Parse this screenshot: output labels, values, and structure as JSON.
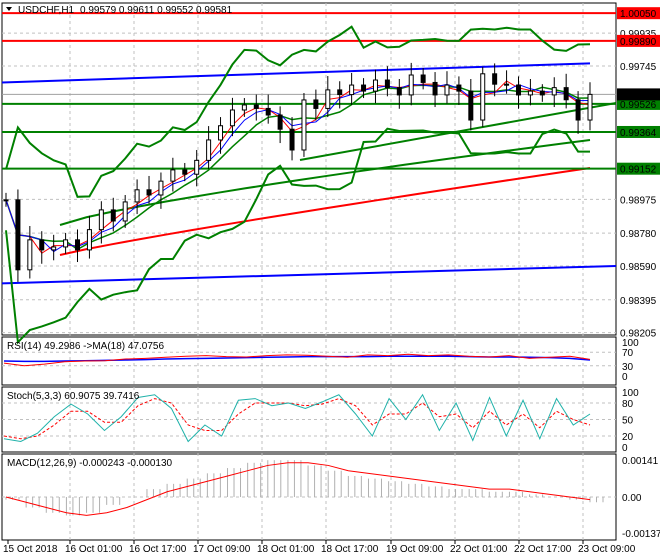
{
  "header": {
    "symbol": "USDCHF,H1",
    "ohlc": "0.99579 0.99611 0.99552 0.99581"
  },
  "chart_data": {
    "type": "line",
    "title": "USDCHF,H1",
    "price_ticks": [
      0.99935,
      0.99745,
      0.98975,
      0.9878,
      0.9859,
      0.98395,
      0.98205
    ],
    "price_range": [
      0.9816,
      1.0013
    ],
    "closes": [
      0.98972,
      0.98568,
      0.98741,
      0.98683,
      0.987,
      0.98741,
      0.98683,
      0.988,
      0.98914,
      0.9885,
      0.9896,
      0.9903,
      0.99,
      0.9908,
      0.99145,
      0.9912,
      0.992,
      0.99318,
      0.994,
      0.99491,
      0.9952,
      0.995,
      0.99462,
      0.9938,
      0.9926,
      0.99549,
      0.995,
      0.99607,
      0.9958,
      0.99635,
      0.996,
      0.99664,
      0.9962,
      0.99578,
      0.99693,
      0.9965,
      0.99578,
      0.99635,
      0.996,
      0.99433,
      0.997,
      0.9964,
      0.99635,
      0.99578,
      0.996,
      0.99578,
      0.9962,
      0.9955,
      0.99433,
      0.99581
    ],
    "levels": [
      {
        "value": 1.0005,
        "label": "1.00050",
        "color": "#ff0000"
      },
      {
        "value": 0.9989,
        "label": "0.99890",
        "color": "#ff0000"
      },
      {
        "value": 0.99526,
        "label": "0.99526",
        "color": "#008000"
      },
      {
        "value": 0.99364,
        "label": "0.99364",
        "color": "#008000"
      },
      {
        "value": 0.99152,
        "label": "0.99152",
        "color": "#008000"
      }
    ],
    "current": {
      "value": 0.99581,
      "label": "0.99581"
    },
    "trendlines": [
      {
        "from": 0.9965,
        "to": 0.9976,
        "color": "#0000ff"
      },
      {
        "from": 0.9849,
        "to": 0.9859,
        "color": "#0000ff"
      }
    ],
    "x_labels": [
      "15 Oct 2018",
      "16 Oct 01:00",
      "16 Oct 17:00",
      "17 Oct 09:00",
      "18 Oct 01:00",
      "18 Oct 17:00",
      "19 Oct 09:00",
      "22 Oct 01:00",
      "22 Oct 17:00",
      "23 Oct 09:00"
    ],
    "rsi": {
      "label": "RSI(14) 49.2986  ->MA(18) 47.0756",
      "ticks": [
        "100",
        "70",
        "30",
        "0"
      ],
      "values": [
        38,
        30,
        35,
        42,
        44,
        45,
        50,
        52,
        55,
        58,
        60,
        57,
        56,
        60,
        62,
        61,
        58,
        55,
        62,
        60,
        64,
        60,
        62,
        58,
        56,
        60,
        52,
        55,
        58,
        49
      ],
      "ma": [
        44,
        43,
        43,
        44,
        45,
        46,
        47,
        48,
        50,
        51,
        52,
        53,
        54,
        55,
        56,
        57,
        57,
        57,
        57,
        58,
        58,
        58,
        58,
        57,
        56,
        56,
        55,
        54,
        52,
        47
      ]
    },
    "stoch": {
      "label": "Stoch(5,3,3) 60.9075 39.7416",
      "ticks": [
        "100",
        "80",
        "50",
        "20",
        "0"
      ],
      "main": [
        15,
        10,
        25,
        55,
        78,
        60,
        30,
        55,
        90,
        95,
        70,
        10,
        40,
        20,
        85,
        88,
        75,
        80,
        70,
        82,
        95,
        60,
        20,
        88,
        50,
        95,
        30,
        80,
        12,
        90,
        20,
        85,
        15,
        88,
        40,
        60
      ],
      "signal": [
        20,
        15,
        20,
        40,
        65,
        65,
        45,
        45,
        75,
        88,
        80,
        40,
        30,
        30,
        60,
        80,
        80,
        80,
        75,
        78,
        88,
        75,
        40,
        60,
        60,
        80,
        55,
        60,
        35,
        65,
        40,
        60,
        35,
        65,
        50,
        40
      ]
    },
    "macd": {
      "label": "MACD(12,26,9) -0.000243 -0.000130",
      "ticks": [
        "0.00141",
        "0.00",
        "-0.001378"
      ],
      "hist": [
        -0.0001,
        -0.0004,
        -0.0006,
        -0.0007,
        -0.0006,
        -0.0003,
        0.0,
        0.0003,
        0.0005,
        0.0007,
        0.0009,
        0.0011,
        0.0013,
        0.0014,
        0.0014,
        0.0012,
        0.001,
        0.0008,
        0.0007,
        0.0006,
        0.0005,
        0.0004,
        0.0003,
        0.0003,
        0.0002,
        0.0002,
        0.0001,
        0.0,
        -0.0001,
        -0.0002
      ],
      "signal": [
        0.0,
        -0.0002,
        -0.0004,
        -0.0006,
        -0.0007,
        -0.0006,
        -0.0004,
        -0.0001,
        0.0002,
        0.0004,
        0.0006,
        0.0008,
        0.001,
        0.0012,
        0.0013,
        0.0013,
        0.0012,
        0.001,
        0.0009,
        0.0008,
        0.0007,
        0.0006,
        0.0005,
        0.0004,
        0.0003,
        0.0003,
        0.0002,
        0.0001,
        0.0,
        -0.0001
      ]
    }
  }
}
